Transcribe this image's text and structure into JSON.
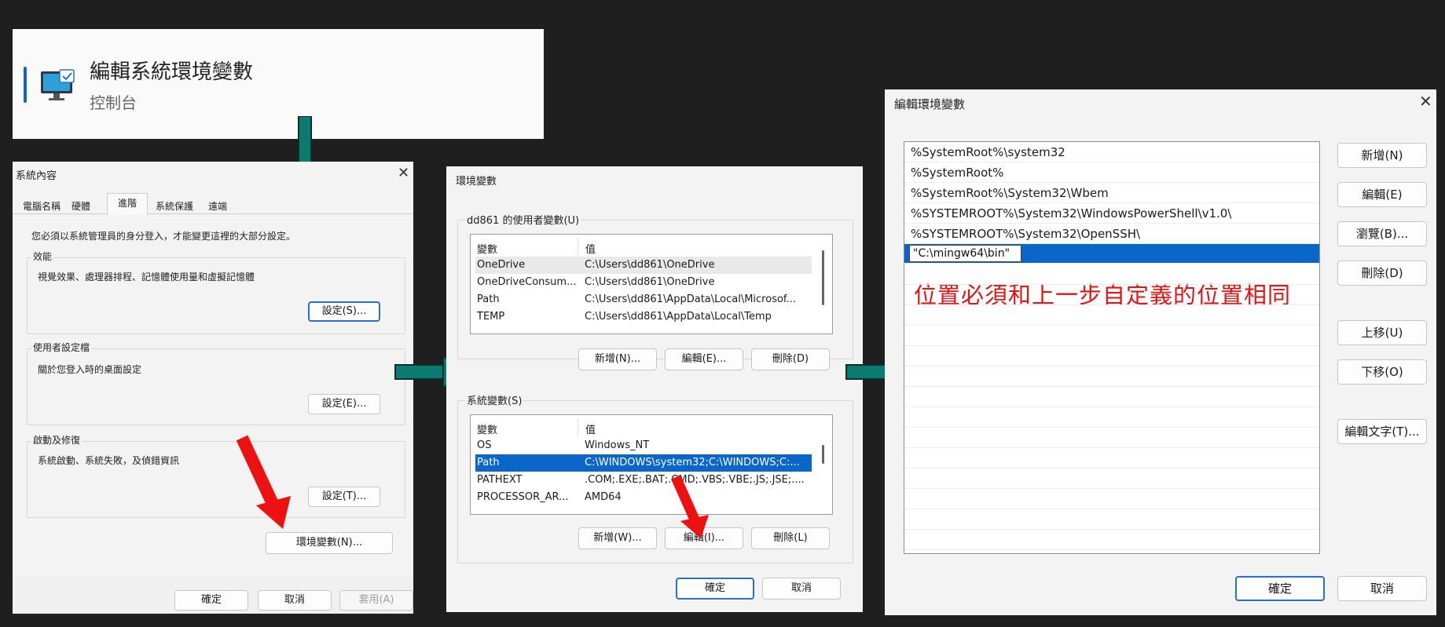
{
  "search_result": {
    "title": "編輯系統環境變數",
    "subtitle": "控制台",
    "icon": "monitor-settings-icon"
  },
  "sysprops": {
    "title": "系統內容",
    "tabs": [
      "電腦名稱",
      "硬體",
      "進階",
      "系統保護",
      "遠端"
    ],
    "admin_note": "您必須以系統管理員的身分登入，才能變更這裡的大部分設定。",
    "perf": {
      "label": "效能",
      "desc": "視覺效果、處理器排程、記憶體使用量和虛擬記憶體",
      "button": "設定(S)..."
    },
    "profile": {
      "label": "使用者設定檔",
      "desc": "關於您登入時的桌面設定",
      "button": "設定(E)..."
    },
    "startup": {
      "label": "啟動及修復",
      "desc": "系統啟動、系統失敗，及偵錯資訊",
      "button": "設定(T)..."
    },
    "env_button": "環境變數(N)...",
    "ok": "確定",
    "cancel": "取消",
    "apply": "套用(A)"
  },
  "envvars": {
    "title": "環境變數",
    "user_group": "dd861 的使用者變數(U)",
    "col_var": "變數",
    "col_val": "值",
    "user_rows": [
      {
        "name": "OneDrive",
        "value": "C:\\Users\\dd861\\OneDrive"
      },
      {
        "name": "OneDriveConsum...",
        "value": "C:\\Users\\dd861\\OneDrive"
      },
      {
        "name": "Path",
        "value": "C:\\Users\\dd861\\AppData\\Local\\Microsof..."
      },
      {
        "name": "TEMP",
        "value": "C:\\Users\\dd861\\AppData\\Local\\Temp"
      }
    ],
    "user_new": "新增(N)...",
    "user_edit": "編輯(E)...",
    "user_delete": "刪除(D)",
    "sys_group": "系統變數(S)",
    "sys_rows": [
      {
        "name": "OS",
        "value": "Windows_NT"
      },
      {
        "name": "Path",
        "value": "C:\\WINDOWS\\system32;C:\\WINDOWS;C:..."
      },
      {
        "name": "PATHEXT",
        "value": ".COM;.EXE;.BAT;.CMD;.VBS;.VBE;.JS;.JSE;...."
      },
      {
        "name": "PROCESSOR_AR...",
        "value": "AMD64"
      }
    ],
    "sys_new": "新增(W)...",
    "sys_edit": "編輯(I)...",
    "sys_delete": "刪除(L)",
    "ok": "確定",
    "cancel": "取消"
  },
  "editenv": {
    "title": "編輯環境變數",
    "paths": [
      "%SystemRoot%\\system32",
      "%SystemRoot%",
      "%SystemRoot%\\System32\\Wbem",
      "%SYSTEMROOT%\\System32\\WindowsPowerShell\\v1.0\\",
      "%SYSTEMROOT%\\System32\\OpenSSH\\"
    ],
    "editing_value": "\"C:\\mingw64\\bin\"",
    "annotation": "位置必須和上一步自定義的位置相同",
    "buttons": {
      "new": "新增(N)",
      "edit": "編輯(E)",
      "browse": "瀏覽(B)...",
      "delete": "刪除(D)",
      "move_up": "上移(U)",
      "move_down": "下移(O)",
      "edit_text": "編輯文字(T)..."
    },
    "ok": "確定",
    "cancel": "取消"
  },
  "colors": {
    "background": "#1f1f1f",
    "arrow_teal": "#0b7a6f",
    "arrow_red": "#ee1111",
    "selection_blue": "#0a66c8",
    "annotation_red": "#e01515"
  }
}
